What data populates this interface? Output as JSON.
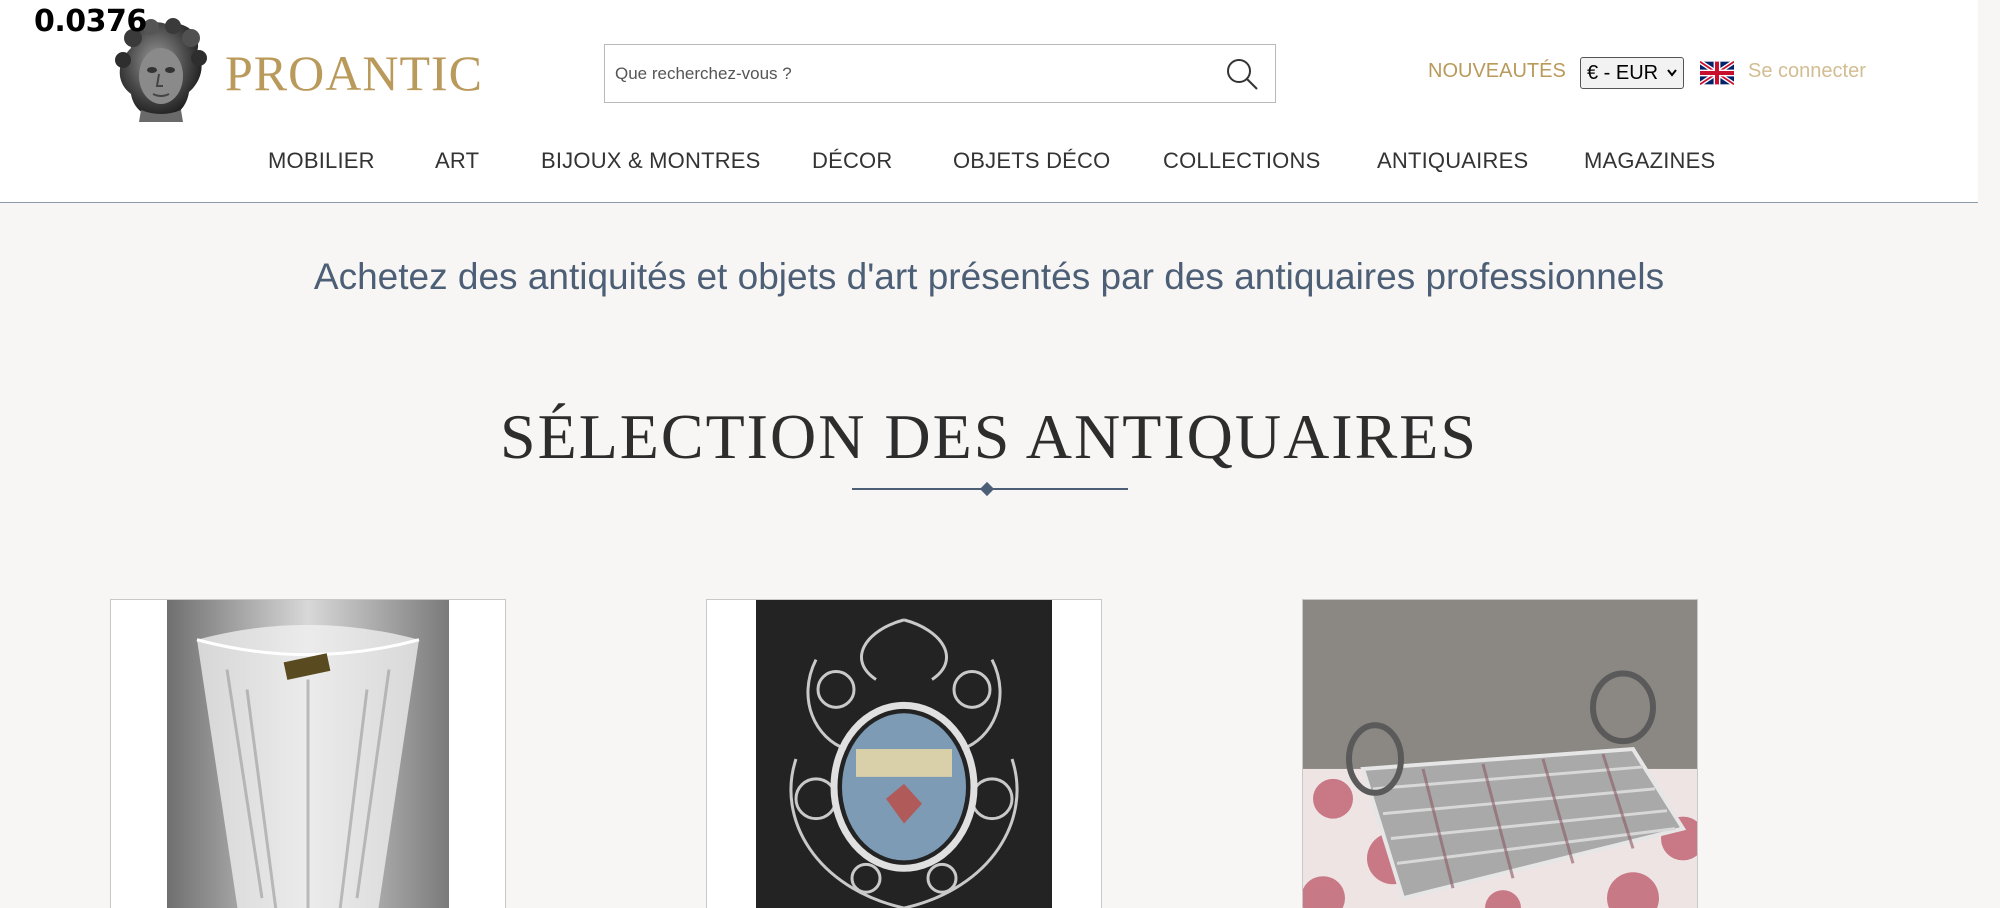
{
  "overlay": {
    "readout": "0.0376"
  },
  "brand": {
    "name": "PROANTIC",
    "color": "#b99a5b",
    "logo_icon": "classical-bust-icon"
  },
  "search": {
    "placeholder": "Que recherchez-vous ?",
    "value": "",
    "icon": "search-icon"
  },
  "header": {
    "new_label": "NOUVEAUTÉS",
    "currency_selected": "€ - EUR",
    "language_icon": "uk-flag-icon",
    "login_label": "Se connecter"
  },
  "nav": {
    "items": [
      {
        "label": "MOBILIER"
      },
      {
        "label": "ART"
      },
      {
        "label": "BIJOUX & MONTRES"
      },
      {
        "label": "DÉCOR"
      },
      {
        "label": "OBJETS DÉCO"
      },
      {
        "label": "COLLECTIONS"
      },
      {
        "label": "ANTIQUAIRES"
      },
      {
        "label": "MAGAZINES"
      }
    ]
  },
  "hero": {
    "tagline": "Achetez des antiquités et objets d'art présentés par des antiquaires professionnels"
  },
  "selection": {
    "title": "SÉLECTION DES ANTIQUAIRES",
    "cards": [
      {
        "image": "crystal-vase-photo"
      },
      {
        "image": "silver-filigree-reliquary-photo"
      },
      {
        "image": "silver-basket-photo"
      }
    ]
  },
  "colors": {
    "accent_gold": "#b99a5b",
    "tagline_blue": "#4d5f76",
    "background": "#f7f6f4"
  }
}
